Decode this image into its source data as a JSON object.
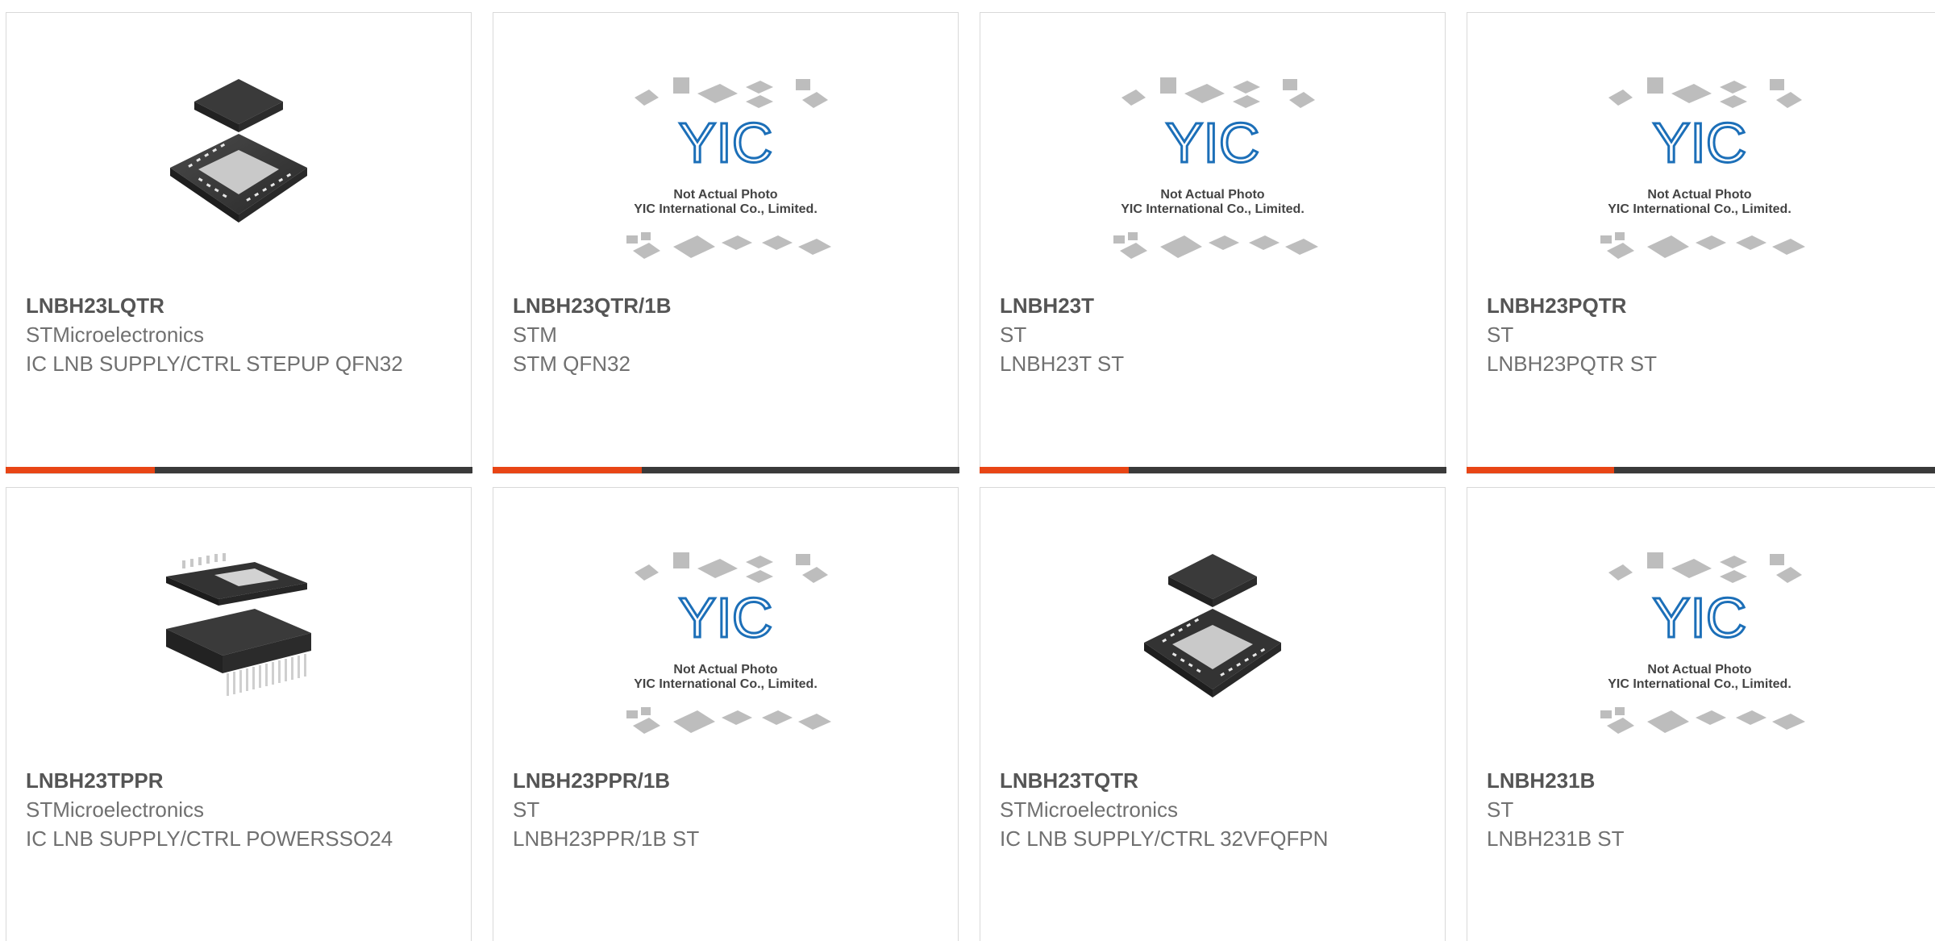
{
  "theme": {
    "accent": "#e84515",
    "bar_dark": "#3a3a3a",
    "text_strong": "#555555",
    "text": "#707070",
    "logo_blue": "#1c6fb8"
  },
  "placeholder": {
    "logo_text": "YIC",
    "line1": "Not Actual Photo",
    "line2": "YIC International Co., Limited."
  },
  "products": [
    {
      "part": "LNBH23LQTR",
      "manufacturer": "STMicroelectronics",
      "description": "IC LNB SUPPLY/CTRL STEPUP QFN32",
      "image": "qfn-chip-icon"
    },
    {
      "part": "LNBH23QTR/1B",
      "manufacturer": "STM",
      "description": "STM QFN32",
      "image": "placeholder"
    },
    {
      "part": "LNBH23T",
      "manufacturer": "ST",
      "description": "LNBH23T ST",
      "image": "placeholder"
    },
    {
      "part": "LNBH23PQTR",
      "manufacturer": "ST",
      "description": "LNBH23PQTR ST",
      "image": "placeholder"
    },
    {
      "part": "LNBH23TPPR",
      "manufacturer": "STMicroelectronics",
      "description": "IC LNB SUPPLY/CTRL POWERSSO24",
      "image": "powersso-chip-icon"
    },
    {
      "part": "LNBH23PPR/1B",
      "manufacturer": "ST",
      "description": "LNBH23PPR/1B ST",
      "image": "placeholder"
    },
    {
      "part": "LNBH23TQTR",
      "manufacturer": "STMicroelectronics",
      "description": "IC LNB SUPPLY/CTRL 32VFQFPN",
      "image": "qfn-chip-icon"
    },
    {
      "part": "LNBH231B",
      "manufacturer": "ST",
      "description": "LNBH231B ST",
      "image": "placeholder"
    }
  ]
}
